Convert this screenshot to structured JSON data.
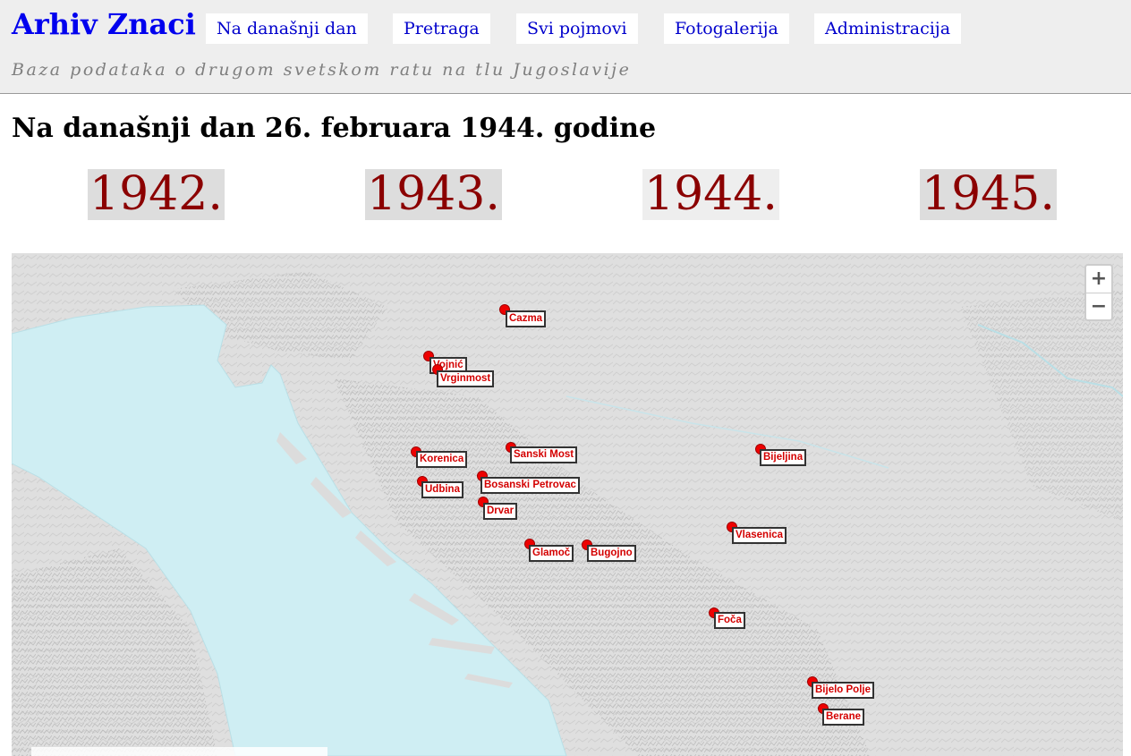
{
  "site": {
    "title": "Arhiv Znaci",
    "subtitle": "Baza podataka o drugom svetskom ratu na tlu Jugoslavije"
  },
  "nav": {
    "items": [
      {
        "label": "Na današnji dan"
      },
      {
        "label": "Pretraga"
      },
      {
        "label": "Svi pojmovi"
      },
      {
        "label": "Fotogalerija"
      },
      {
        "label": "Administracija"
      }
    ]
  },
  "page": {
    "title": "Na današnji dan 26. februara 1944. godine"
  },
  "years": {
    "items": [
      {
        "label": "1942."
      },
      {
        "label": "1943."
      },
      {
        "label": "1944.",
        "selected": true
      },
      {
        "label": "1945."
      }
    ]
  },
  "map": {
    "zoom_in_label": "+",
    "zoom_out_label": "−",
    "marker_color": "#ee0000",
    "label_text_color": "#d40000",
    "sea_color": "#cfeef3",
    "places": [
      {
        "name": "Cazma"
      },
      {
        "name": "Vojnić"
      },
      {
        "name": "Vrginmost"
      },
      {
        "name": "Korenica"
      },
      {
        "name": "Sanski Most"
      },
      {
        "name": "Bosanski Petrovac"
      },
      {
        "name": "Udbina"
      },
      {
        "name": "Drvar"
      },
      {
        "name": "Glamoč"
      },
      {
        "name": "Bugojno"
      },
      {
        "name": "Bijeljina"
      },
      {
        "name": "Vlasenica"
      },
      {
        "name": "Foča"
      },
      {
        "name": "Bijelo Polje"
      },
      {
        "name": "Berane"
      }
    ]
  }
}
